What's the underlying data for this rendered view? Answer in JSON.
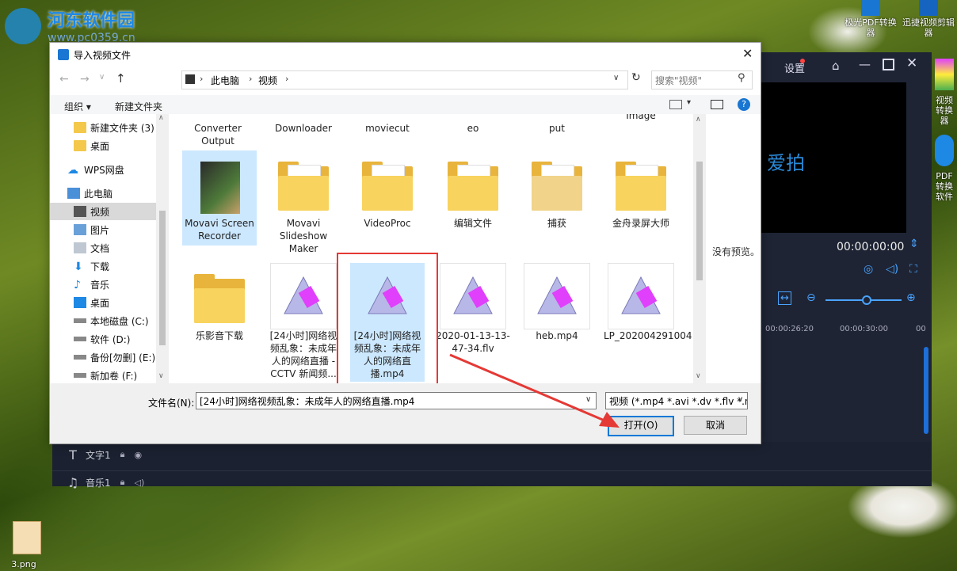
{
  "watermark": {
    "site": "河东软件园",
    "url": "www.pc0359.cn"
  },
  "desktop": {
    "icon1": "极光PDF转换器",
    "icon2": "迅捷视频剪辑器",
    "icon3": "视频转换器",
    "icon4": "PDF转换软件",
    "file": "3.png"
  },
  "app": {
    "settings": "设置",
    "preview_text": "爱拍",
    "time": "00:00:00:00",
    "ruler": [
      "00:00:26:20",
      "00:00:30:00",
      "00"
    ],
    "tracks": [
      {
        "icon": "T",
        "label": "文字1"
      },
      {
        "icon": "♫",
        "label": "音乐1"
      }
    ]
  },
  "dialog": {
    "title": "导入视频文件",
    "breadcrumb": [
      "此电脑",
      "视频"
    ],
    "search_placeholder": "搜索\"视频\"",
    "toolbar": {
      "organize": "组织 ▾",
      "new_folder": "新建文件夹"
    },
    "nav": [
      {
        "label": "新建文件夹 (3)",
        "icon": "folder-icon"
      },
      {
        "label": "桌面",
        "icon": "folder-icon"
      },
      {
        "label": "WPS网盘",
        "icon": "cloud-icon"
      },
      {
        "label": "此电脑",
        "icon": "computer-icon"
      },
      {
        "label": "视频",
        "icon": "video-folder-icon"
      },
      {
        "label": "图片",
        "icon": "picture-folder-icon"
      },
      {
        "label": "文档",
        "icon": "document-folder-icon"
      },
      {
        "label": "下载",
        "icon": "download-icon"
      },
      {
        "label": "音乐",
        "icon": "music-icon"
      },
      {
        "label": "桌面",
        "icon": "desktop-icon"
      },
      {
        "label": "本地磁盘 (C:)",
        "icon": "drive-icon"
      },
      {
        "label": "软件 (D:)",
        "icon": "drive-icon"
      },
      {
        "label": "备份[勿删] (E:)",
        "icon": "drive-icon"
      },
      {
        "label": "新加卷 (F:)",
        "icon": "drive-icon"
      }
    ],
    "top_row": [
      "Converter Output",
      "Downloader",
      "moviecut",
      "eo",
      "put",
      "Image"
    ],
    "items": [
      {
        "label": "Movavi Screen Recorder",
        "kind": "movavi",
        "selected": "false"
      },
      {
        "label": "Movavi Slideshow Maker",
        "kind": "folder"
      },
      {
        "label": "VideoProc",
        "kind": "folder"
      },
      {
        "label": "编辑文件",
        "kind": "folder"
      },
      {
        "label": "捕获",
        "kind": "folder"
      },
      {
        "label": "金舟录屏大师",
        "kind": "folder"
      },
      {
        "label": "乐影音下载",
        "kind": "plainfolder"
      },
      {
        "label": "[24小时]网络视频乱象：未成年人的网络直播 - CCTV 新闻频...",
        "kind": "video"
      },
      {
        "label": "[24小时]网络视频乱象：未成年人的网络直播.mp4",
        "kind": "video",
        "selected": "true"
      },
      {
        "label": "2020-01-13-13-47-34.flv",
        "kind": "video"
      },
      {
        "label": "heb.mp4",
        "kind": "video"
      },
      {
        "label": "LP_20200429100458.flv",
        "kind": "video"
      }
    ],
    "no_preview": "没有预览。",
    "filename_label": "文件名(N):",
    "filename_value": "[24小时]网络视频乱象：未成年人的网络直播.mp4",
    "filetype_value": "视频 (*.mp4 *.avi *.dv *.flv *.n",
    "open_label": "打开(O)",
    "cancel_label": "取消"
  },
  "colors": {
    "accent": "#0078d7",
    "highlight": "#e53935"
  }
}
